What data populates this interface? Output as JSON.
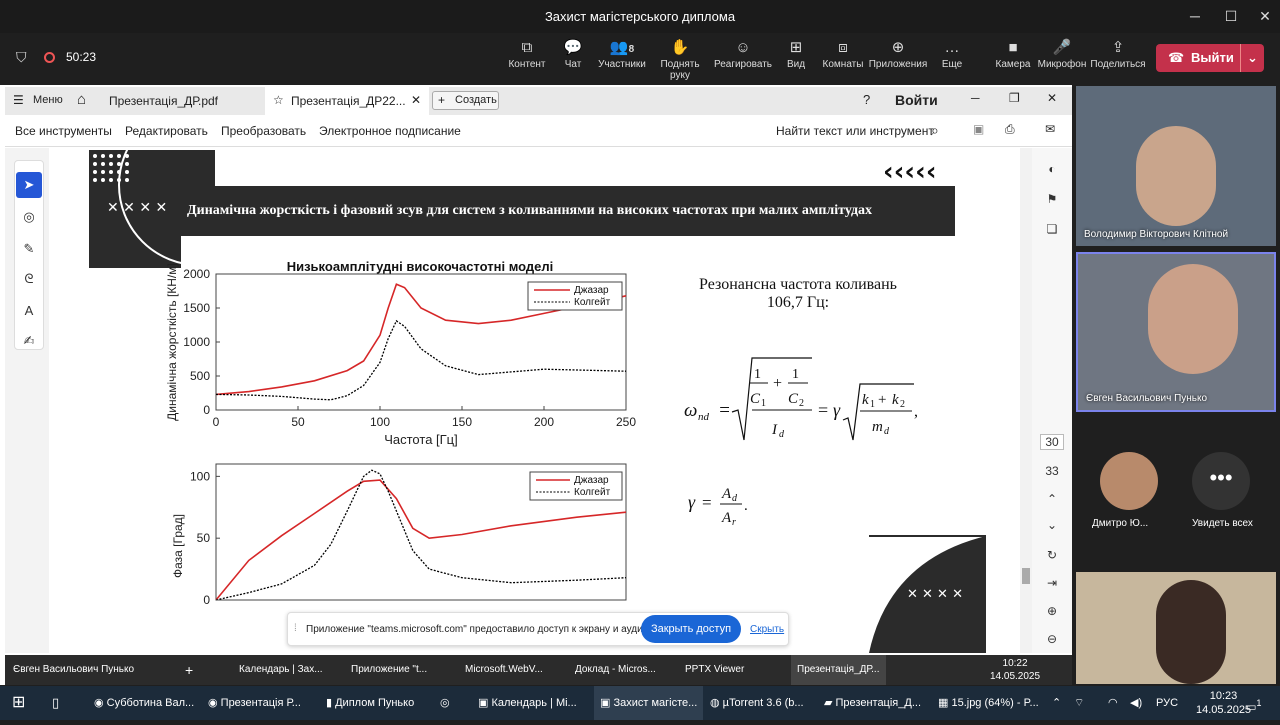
{
  "window": {
    "title": "Захист магістерського диплома"
  },
  "meeting": {
    "timer": "50:23",
    "participants_count": "8",
    "buttons": [
      "Контент",
      "Чат",
      "Участники",
      "Поднять руку",
      "Реагировать",
      "Вид",
      "Комнаты",
      "Приложения",
      "Еще",
      "Камера",
      "Микрофон",
      "Поделиться"
    ],
    "leave": "Выйти"
  },
  "pdf": {
    "menu": "Меню",
    "tab1": "Презентація_ДР.pdf",
    "tab2": "Презентація_ДР22...",
    "new_tab": "Создать",
    "signin": "Войти",
    "tools": [
      "Все инструменты",
      "Редактировать",
      "Преобразовать",
      "Электронное подписание"
    ],
    "search": "Найти текст или инструмент",
    "page_current": "30",
    "page_total": "33"
  },
  "slide": {
    "banner": "Динамічна жорсткість і фазовий зсув для систем з коливаннями на високих частотах при малих амплітудах",
    "resonance_line1": "Резонансна частота  коливань",
    "resonance_line2": "106,7 Гц:"
  },
  "chart_data": [
    {
      "type": "line",
      "title": "Низькоамплітудні високочастотні моделі",
      "xlabel": "Частота [Гц]",
      "ylabel": "Динамічна жорсткість [КН/м]",
      "xlim": [
        0,
        250
      ],
      "ylim": [
        0,
        2000
      ],
      "xticks": [
        "0",
        "50",
        "100",
        "150",
        "200",
        "250"
      ],
      "yticks": [
        "0",
        "500",
        "1000",
        "1500",
        "2000"
      ],
      "legend": "top-right",
      "series": [
        {
          "name": "Джазар",
          "color": "#d62728",
          "x": [
            0,
            20,
            40,
            60,
            80,
            90,
            100,
            105,
            110,
            115,
            125,
            140,
            160,
            180,
            200,
            230,
            250
          ],
          "y": [
            230,
            270,
            340,
            430,
            580,
            720,
            1100,
            1500,
            1850,
            1800,
            1500,
            1320,
            1270,
            1320,
            1420,
            1570,
            1680
          ]
        },
        {
          "name": "Колгейт",
          "color": "#000000",
          "x": [
            0,
            20,
            40,
            60,
            70,
            80,
            90,
            100,
            105,
            110,
            115,
            125,
            140,
            160,
            200,
            250
          ],
          "y": [
            230,
            220,
            200,
            160,
            150,
            210,
            360,
            700,
            1050,
            1310,
            1230,
            900,
            650,
            520,
            600,
            570
          ]
        }
      ]
    },
    {
      "type": "line",
      "xlabel": "",
      "ylabel": "Фаза [Град]",
      "xlim": [
        0,
        250
      ],
      "ylim": [
        0,
        110
      ],
      "yticks": [
        "0",
        "50",
        "100"
      ],
      "legend": "top-right",
      "series": [
        {
          "name": "Джазар",
          "color": "#d62728",
          "x": [
            0,
            20,
            40,
            60,
            80,
            90,
            100,
            110,
            120,
            130,
            150,
            180,
            220,
            250
          ],
          "y": [
            0,
            32,
            52,
            70,
            88,
            96,
            97,
            82,
            58,
            50,
            53,
            60,
            67,
            71
          ]
        },
        {
          "name": "Колгейт",
          "color": "#000000",
          "x": [
            0,
            20,
            40,
            60,
            70,
            80,
            90,
            95,
            100,
            105,
            110,
            120,
            130,
            150,
            180,
            220,
            250
          ],
          "y": [
            0,
            6,
            13,
            28,
            45,
            72,
            100,
            105,
            102,
            88,
            72,
            40,
            25,
            18,
            14,
            16,
            18
          ]
        }
      ]
    }
  ],
  "notification": {
    "text": "Приложение \"teams.microsoft.com\" предоставило доступ к экрану и аудио.",
    "share_btn": "Закрыть доступ",
    "hide": "Скрыть"
  },
  "inner_taskbar": [
    "Євген Васильович Пунько",
    "Календарь | Зах...",
    "Приложение \"t...",
    "Microsoft.WebV...",
    "Доклад - Micros...",
    "PPTX Viewer",
    "Презентація_ДР...",
    "10:22",
    "14.05.2025"
  ],
  "participants": [
    {
      "name": "Володимир Вікторович Клітной"
    },
    {
      "name": "Євген Васильович Пунько"
    },
    {
      "name": "Дмитро Ю..."
    },
    {
      "name": "Увидеть всех"
    }
  ],
  "taskbar": {
    "items": [
      "Субботина Вал...",
      "Презентація Р...",
      "Диплом Пунько",
      "Календарь | Мі...",
      "Захист магісте...",
      "µTorrent 3.6  (b...",
      "Презентація_Д...",
      "15.jpg (64%) - P..."
    ],
    "lang": "РУС",
    "time": "10:23",
    "date": "14.05.2025",
    "notif": "1"
  }
}
